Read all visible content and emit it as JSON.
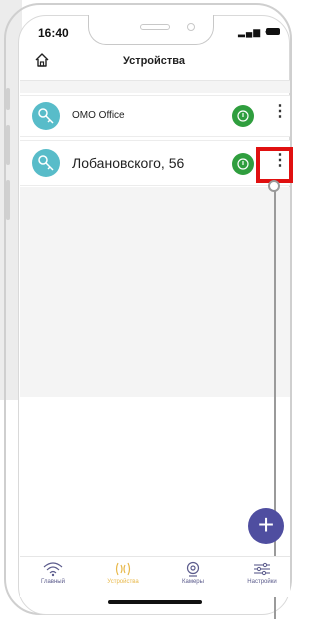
{
  "status_bar": {
    "time": "16:40",
    "icons": "▂▄▆ ◠"
  },
  "header": {
    "title": "Устройства"
  },
  "devices": [
    {
      "name": "OMO Office"
    },
    {
      "name": "Лобановского, 56"
    }
  ],
  "fab": {
    "label": "+"
  },
  "tabs": [
    {
      "label": "Главный"
    },
    {
      "label": "Устройства"
    },
    {
      "label": "Камеры"
    },
    {
      "label": "Настройки"
    }
  ],
  "colors": {
    "accent": "#4f4ea0",
    "avatar": "#58bcc9",
    "power": "#2f9e3e",
    "active_tab": "#e8b84a",
    "highlight": "#e01010"
  }
}
